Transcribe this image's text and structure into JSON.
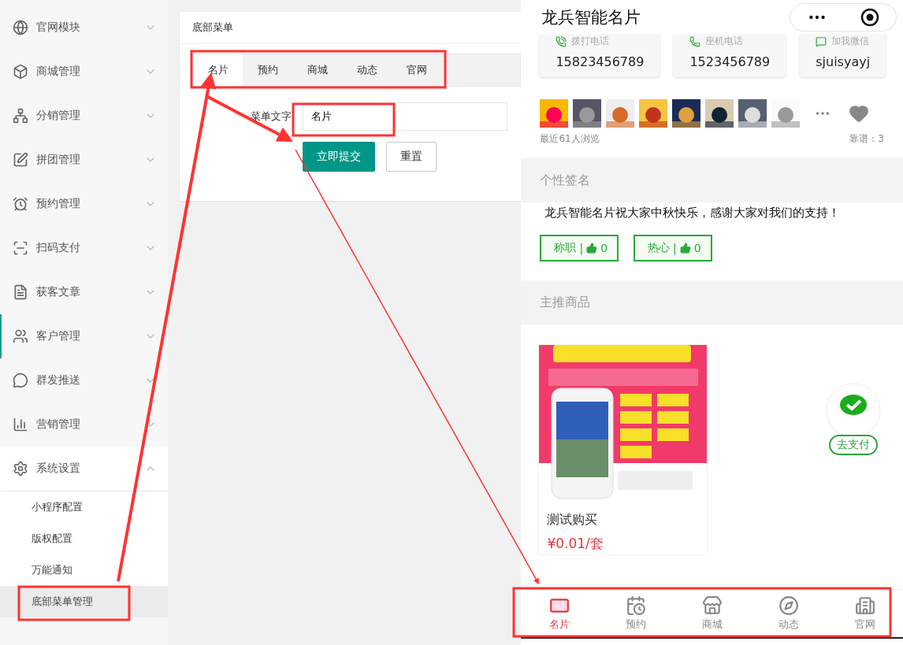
{
  "sidebar": {
    "items": [
      {
        "label": "官网模块",
        "expanded": false,
        "highlighted": false
      },
      {
        "label": "商城管理",
        "expanded": false,
        "highlighted": false
      },
      {
        "label": "分销管理",
        "expanded": false,
        "highlighted": false
      },
      {
        "label": "拼团管理",
        "expanded": false,
        "highlighted": false
      },
      {
        "label": "预约管理",
        "expanded": false,
        "highlighted": false
      },
      {
        "label": "扫码支付",
        "expanded": false,
        "highlighted": false
      },
      {
        "label": "获客文章",
        "expanded": false,
        "highlighted": false
      },
      {
        "label": "客户管理",
        "expanded": false,
        "highlighted": true
      },
      {
        "label": "群发推送",
        "expanded": false,
        "highlighted": false
      },
      {
        "label": "营销管理",
        "expanded": false,
        "highlighted": false
      },
      {
        "label": "系统设置",
        "expanded": true,
        "highlighted": false,
        "children": [
          {
            "label": "小程序配置",
            "selected": false
          },
          {
            "label": "版权配置",
            "selected": false
          },
          {
            "label": "万能通知",
            "selected": false
          },
          {
            "label": "底部菜单管理",
            "selected": true
          }
        ]
      }
    ]
  },
  "panel": {
    "title": "底部菜单",
    "tabs": [
      {
        "label": "名片",
        "selected": true
      },
      {
        "label": "预约",
        "selected": false
      },
      {
        "label": "商城",
        "selected": false
      },
      {
        "label": "动态",
        "selected": false
      },
      {
        "label": "官网",
        "selected": false
      }
    ],
    "field": {
      "label": "菜单文字",
      "value": "名片"
    },
    "buttons": [
      {
        "label": "立即提交",
        "kind": "primary"
      },
      {
        "label": "重置",
        "kind": "plain"
      }
    ]
  },
  "phone": {
    "title": "龙兵智能名片",
    "contacts": [
      {
        "label": "拨打电话",
        "value": "15823456789"
      },
      {
        "label": "座机电话",
        "value": "1523456789"
      },
      {
        "label": "加我微信",
        "value": "sjuisyayj"
      }
    ],
    "visitors": "最近61人浏览",
    "rating": "靠谱：3",
    "signature_heading": "个性签名",
    "signature": "龙兵智能名片祝大家中秋快乐，感谢大家对我们的支持！",
    "likes": [
      {
        "label": "称职",
        "separator": "|",
        "count": "0"
      },
      {
        "label": "热心",
        "separator": "|",
        "count": "0"
      }
    ],
    "products_heading": "主推商品",
    "product": {
      "kind": "picture",
      "name": "测试购买",
      "price": "¥0.01/套"
    },
    "pay_button": "去支付",
    "tabbar": [
      {
        "label": "名片",
        "selected": true
      },
      {
        "label": "预约",
        "selected": false
      },
      {
        "label": "商城",
        "selected": false
      },
      {
        "label": "动态",
        "selected": false
      },
      {
        "label": "官网",
        "selected": false
      }
    ]
  }
}
